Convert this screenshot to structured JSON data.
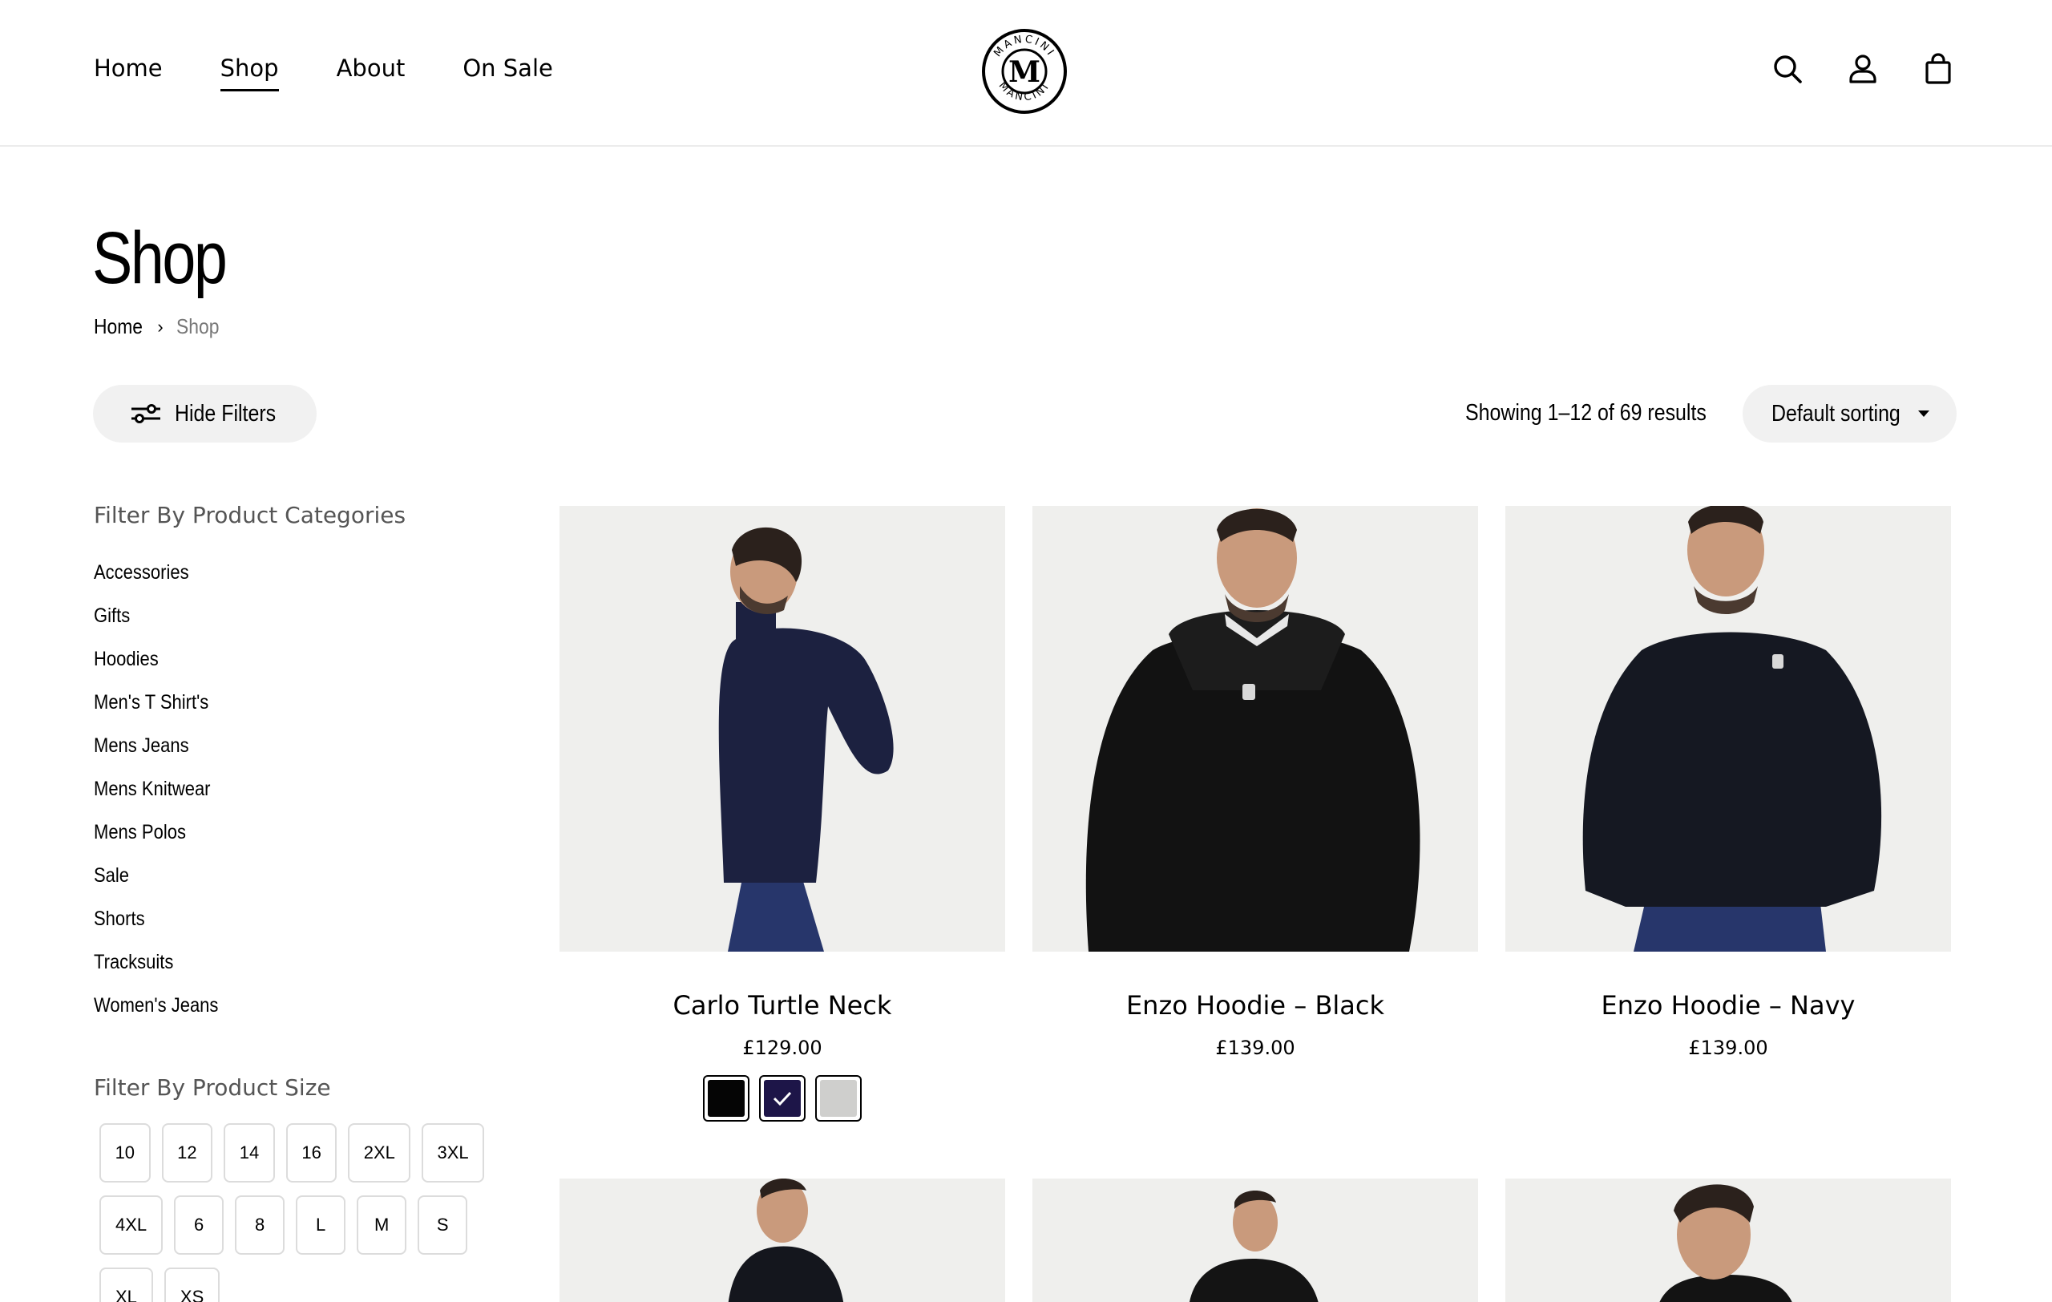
{
  "header": {
    "nav": [
      {
        "label": "Home",
        "active": false
      },
      {
        "label": "Shop",
        "active": true
      },
      {
        "label": "About",
        "active": false
      },
      {
        "label": "On Sale",
        "active": false
      }
    ],
    "logo_text": "MANCINI",
    "icons": [
      "search-icon",
      "account-icon",
      "bag-icon"
    ]
  },
  "page": {
    "title": "Shop",
    "breadcrumb": {
      "home": "Home",
      "current": "Shop"
    }
  },
  "toolbar": {
    "hide_filters_label": "Hide Filters",
    "results_text": "Showing 1–12 of 69 results",
    "sorting_label": "Default sorting"
  },
  "sidebar": {
    "categories_heading": "Filter By Product Categories",
    "categories": [
      "Accessories",
      "Gifts",
      "Hoodies",
      "Men's T Shirt's",
      "Mens Jeans",
      "Mens Knitwear",
      "Mens Polos",
      "Sale",
      "Shorts",
      "Tracksuits",
      "Women's Jeans"
    ],
    "size_heading": "Filter By Product Size",
    "sizes": [
      [
        "10",
        "12",
        "14",
        "16",
        "2XL",
        "3XL"
      ],
      [
        "4XL",
        "6",
        "8",
        "L",
        "M",
        "S"
      ],
      [
        "XL",
        "XS"
      ]
    ]
  },
  "products": [
    {
      "name": "Carlo Turtle Neck",
      "price": "£129.00",
      "garment_color": "#1c2140",
      "swatches": [
        "#050505",
        "#1d1548",
        "#cfcfcd"
      ],
      "selected_swatch": 1
    },
    {
      "name": "Enzo Hoodie – Black",
      "price": "£139.00",
      "garment_color": "#121212"
    },
    {
      "name": "Enzo Hoodie – Navy",
      "price": "£139.00",
      "garment_color": "#151822"
    },
    {
      "garment_color": "#14161d"
    },
    {
      "garment_color": "#141414"
    },
    {
      "garment_color": "#131313"
    }
  ],
  "colors": {
    "pill_bg": "#f1f1f1",
    "image_bg": "#efefed",
    "skin": "#c99a7c",
    "hair": "#2b211c",
    "jeans": "#27366b"
  }
}
